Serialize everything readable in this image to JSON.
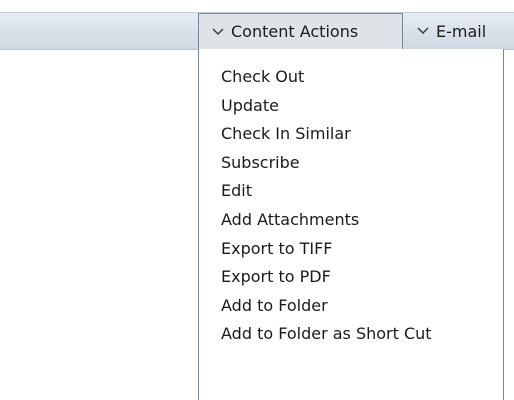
{
  "toolbar": {
    "tabs": [
      {
        "label": "Content Actions",
        "icon": "chevron-down-icon",
        "active": true
      },
      {
        "label": "E-mail",
        "icon": "chevron-down-icon",
        "active": false
      }
    ]
  },
  "dropdown": {
    "items": [
      "Check Out",
      "Update",
      "Check In Similar",
      "Subscribe",
      "Edit",
      "Add Attachments",
      "Export to TIFF",
      "Export to PDF",
      "Add to Folder",
      "Add to Folder as Short Cut"
    ]
  }
}
